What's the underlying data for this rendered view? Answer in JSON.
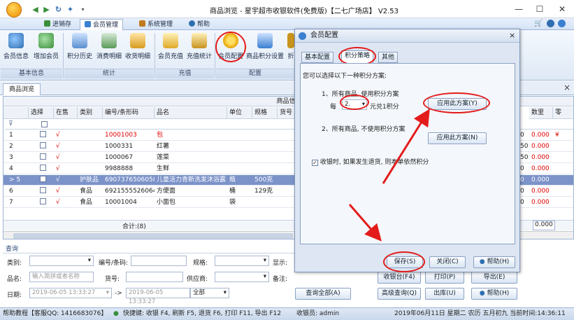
{
  "window": {
    "title": "商品浏览 - 星宇超市收银软件(免费版)【二七广场店】 V2.53",
    "min": "—",
    "max": "☐",
    "close": "✕"
  },
  "menu": {
    "tabs": [
      "进销存",
      "会员管理",
      "系统管理",
      "帮助"
    ],
    "active_index": 1,
    "right_icons": [
      "cart-icon",
      "info-icon",
      "settings-icon"
    ]
  },
  "ribbon": {
    "buttons": [
      "会员信息",
      "增加会员",
      "积分历史",
      "消费明细",
      "收货明细",
      "会员充值",
      "充值统计",
      "会员配置",
      "商品积分设置",
      "折"
    ],
    "groups": [
      "基本信息",
      "统计",
      "充值",
      "配置"
    ]
  },
  "doc_tab": {
    "label": "商品浏览",
    "close": "×"
  },
  "grid": {
    "group_header": "商品信息",
    "columns": [
      "选择",
      "在售",
      "类别",
      "编号/条形码",
      "品名",
      "单位",
      "规格",
      "货号"
    ],
    "right_columns": [
      "数里",
      "零"
    ],
    "rows": [
      {
        "num": "1",
        "onsale": "√",
        "category": "",
        "code": "10001003",
        "name": "包",
        "unit": "",
        "spec": "",
        "right_a": "0",
        "right_b": "0.000",
        "right_c": "¥",
        "red": true
      },
      {
        "num": "2",
        "onsale": "√",
        "category": "",
        "code": "1000331",
        "name": "红薯",
        "unit": "",
        "spec": "",
        "right_a": "50",
        "right_b": "0.000",
        "right_c": "",
        "red": false
      },
      {
        "num": "3",
        "onsale": "√",
        "category": "",
        "code": "1000067",
        "name": "莲菜",
        "unit": "",
        "spec": "",
        "right_a": "50",
        "right_b": "0.000",
        "right_c": "",
        "red": false
      },
      {
        "num": "4",
        "onsale": "√",
        "category": "",
        "code": "9988888",
        "name": "生鲜",
        "unit": "",
        "spec": "",
        "right_a": "0",
        "right_b": "0.000",
        "right_c": "",
        "red": false
      },
      {
        "num": "5",
        "onsale": "√",
        "category": "护肤品",
        "code": "6907376506058",
        "name": "儿童活力青新洗发沐浴露",
        "unit": "瓶",
        "spec": "500克",
        "right_a": "0",
        "right_b": "0.000",
        "right_c": "",
        "red": false
      },
      {
        "num": "6",
        "onsale": "√",
        "category": "食品",
        "code": "6921555526064",
        "name": "方便面",
        "unit": "桶",
        "spec": "129克",
        "right_a": "0",
        "right_b": "0.000",
        "right_c": "",
        "red": false
      },
      {
        "num": "7",
        "onsale": "√",
        "category": "食品",
        "code": "10001004",
        "name": "小面包",
        "unit": "袋",
        "spec": "",
        "right_a": "0",
        "right_b": "0.000",
        "right_c": "",
        "red": false
      }
    ],
    "selected_row": 4,
    "footer_total": "合计:(8)",
    "footer_right": "0.000"
  },
  "filters": {
    "section_title": "查询",
    "category_label": "类别:",
    "code_label": "编号/条码:",
    "spec_label": "规格:",
    "display_label": "显示:",
    "name_label": "品名:",
    "name_placeholder": "输入简拼或者名称",
    "item_no_label": "货号:",
    "supplier_label": "供应商:",
    "remark_label": "备注:",
    "date_label": "日期:",
    "date_from": "2019-06-05 13:33:27",
    "date_sep": "->",
    "date_to": "2019-06-05 13:33:27",
    "date_range": "全部",
    "btn_query_all": "查询全部(A)",
    "btn_advanced": "高级查询(Q)",
    "btn_out": "出库(U)",
    "btn_help": "帮助(H)",
    "btn_checkout": "收银台(F4)",
    "btn_print": "打印(P)",
    "btn_export": "导出(E)"
  },
  "status": {
    "help": "帮助教程【客服QQ: 1416683076】",
    "shortcuts": "快捷键: 收银 F4, 刷新 F5, 退货 F6, 打印 F11, 导出 F12",
    "cashier": "收银员: admin",
    "datetime": "2019年06月11日 星期二 农历 五月初九 当前时间:14:36:11"
  },
  "dialog": {
    "title": "会员配置",
    "close": "×",
    "tabs": [
      "基本配置",
      "积分策略",
      "其他"
    ],
    "active_tab": 1,
    "prompt": "您可以选择以下一种积分方案:",
    "option1": "1、所有商品, 使用积分方案",
    "per_label": "每",
    "per_value": "2.",
    "per_suffix": "元兑1积分",
    "apply_btn": "应用此方案(Y)",
    "option2": "2、所有商品, 不使用积分方案",
    "apply_btn2": "应用此方案(N)",
    "checkbox_label": "收银时, 如果发生退货, 则本单依然积分",
    "checkbox_checked": true,
    "save": "保存(S)",
    "close_btn": "关闭(C)",
    "help": "帮助(H)"
  },
  "colors": {
    "accent": "#e41b1b",
    "selected_row": "#7c93c9",
    "ribbon": "#dfe9f6"
  }
}
